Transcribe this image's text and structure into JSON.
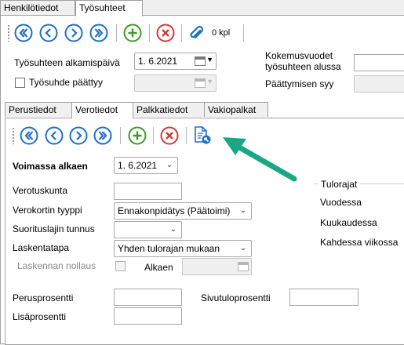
{
  "top_tabs": [
    {
      "label": "Henkilötiedot",
      "active": false
    },
    {
      "label": "Työsuhteet",
      "active": true
    }
  ],
  "top_toolbar": {
    "buttons": [
      "first-icon",
      "previous-icon",
      "next-icon",
      "last-icon",
      "add-icon",
      "delete-icon",
      "attachment-icon"
    ],
    "attachment_count": "0 kpl"
  },
  "employment": {
    "start_label": "Työsuhteen alkamispäivä",
    "start_value": "1. 6.2021",
    "ended_label": "Työsuhde päättyy",
    "experience_label_line1": "Kokemusvuodet",
    "experience_label_line2": "työsuhteen alussa",
    "end_reason_label": "Päättymisen syy"
  },
  "sub_tabs": [
    {
      "label": "Perustiedot",
      "active": false
    },
    {
      "label": "Verotiedot",
      "active": true
    },
    {
      "label": "Palkkatiedot",
      "active": false
    },
    {
      "label": "Vakiopalkat",
      "active": false
    }
  ],
  "tax": {
    "valid_from_label": "Voimassa alkaen",
    "valid_from_value": "1. 6.2021",
    "municipality_label": "Verotuskunta",
    "municipality_value": "",
    "card_type_label": "Verokortin tyyppi",
    "card_type_value": "Ennakonpidätys (Päätoimi)",
    "payment_type_label": "Suorituslajin tunnus",
    "payment_type_value": "",
    "calc_method_label": "Laskentatapa",
    "calc_method_value": "Yhden tulorajan mukaan",
    "reset_label": "Laskennan nollaus",
    "reset_from_label": "Alkaen",
    "base_percent_label": "Perusprosentti",
    "extra_percent_label": "Lisäprosentti",
    "side_percent_label": "Sivutuloprosentti"
  },
  "income_limits": {
    "title": "Tulorajat",
    "rows": [
      "Vuodessa",
      "Kuukaudessa",
      "Kahdessa viikossa"
    ]
  },
  "colors": {
    "nav_blue": "#1f6fc5",
    "add_green": "#3e9a2b",
    "delete_red": "#d23a3a",
    "arrow_teal": "#1aa784"
  }
}
